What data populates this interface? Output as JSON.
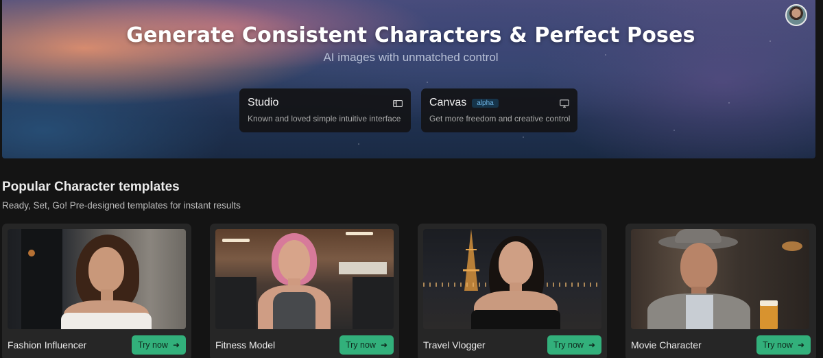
{
  "hero": {
    "title": "Generate Consistent Characters & Perfect Poses",
    "subtitle": "AI images with unmatched control"
  },
  "modes": [
    {
      "title": "Studio",
      "description": "Known and loved simple intuitive interface",
      "icon": "sidebar-layout-icon"
    },
    {
      "title": "Canvas",
      "badge": "alpha",
      "description": "Get more freedom and creative control",
      "icon": "canvas-screen-icon"
    }
  ],
  "templates": {
    "title": "Popular Character templates",
    "subtitle": "Ready, Set, Go! Pre-designed templates for instant results",
    "button_label": "Try now",
    "items": [
      {
        "name": "Fashion Influencer"
      },
      {
        "name": "Fitness Model"
      },
      {
        "name": "Travel Vlogger"
      },
      {
        "name": "Movie Character"
      }
    ]
  },
  "colors": {
    "accent": "#32b07b",
    "background": "#141414",
    "card": "#262626",
    "badge_text": "#6fb6e6"
  }
}
